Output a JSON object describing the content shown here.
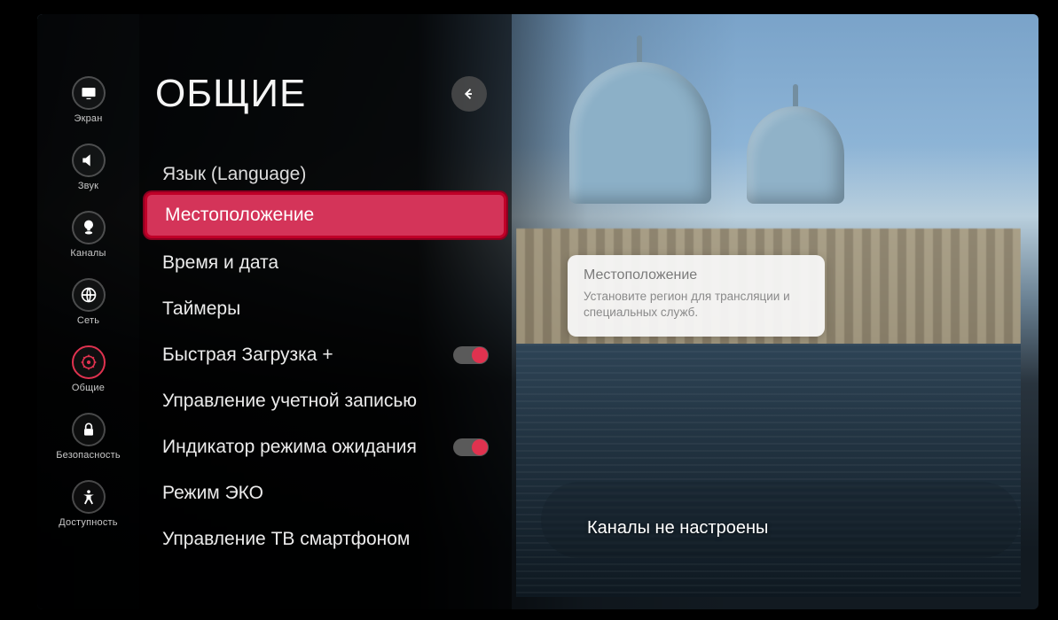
{
  "sidebar": {
    "items": [
      {
        "label": "Экран"
      },
      {
        "label": "Звук"
      },
      {
        "label": "Каналы"
      },
      {
        "label": "Сеть"
      },
      {
        "label": "Общие"
      },
      {
        "label": "Безопасность"
      },
      {
        "label": "Доступность"
      }
    ]
  },
  "panel": {
    "title": "ОБЩИЕ",
    "items": {
      "language": "Язык (Language)",
      "location": "Местоположение",
      "datetime": "Время и дата",
      "timers": "Таймеры",
      "quickstart": "Быстрая Загрузка +",
      "account": "Управление учетной записью",
      "standby": "Индикатор режима ожидания",
      "eco": "Режим ЭКО",
      "tvphone": "Управление ТВ смартфоном"
    }
  },
  "info": {
    "title": "Местоположение",
    "body": "Установите регион для трансляции и специальных служб."
  },
  "channel_status": "Каналы не настроены",
  "colors": {
    "accent": "#e0324f",
    "selected": "#d43459"
  }
}
